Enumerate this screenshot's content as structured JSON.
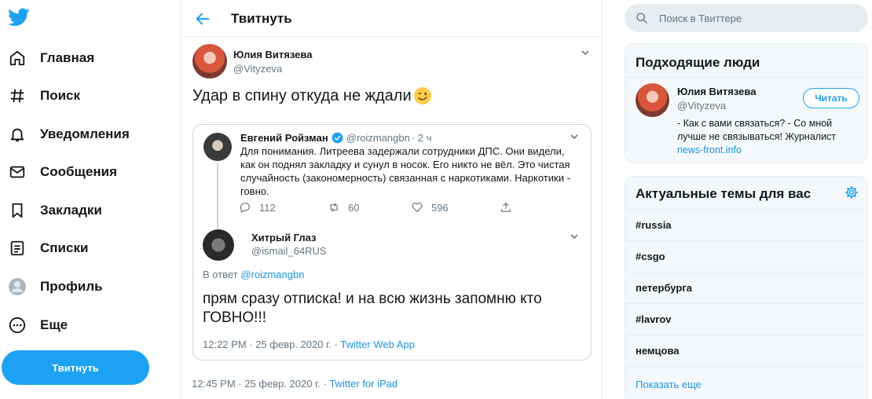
{
  "nav": {
    "items": [
      {
        "label": "Главная",
        "icon": "home-icon"
      },
      {
        "label": "Поиск",
        "icon": "hashtag-icon"
      },
      {
        "label": "Уведомления",
        "icon": "bell-icon"
      },
      {
        "label": "Сообщения",
        "icon": "envelope-icon"
      },
      {
        "label": "Закладки",
        "icon": "bookmark-icon"
      },
      {
        "label": "Списки",
        "icon": "list-icon"
      },
      {
        "label": "Профиль",
        "icon": "avatar-icon"
      },
      {
        "label": "Еще",
        "icon": "more-icon"
      }
    ],
    "tweet_button": "Твитнуть"
  },
  "header": {
    "title": "Твитнуть"
  },
  "tweet": {
    "author_name": "Юлия Витязева",
    "author_handle": "@Vityzeva",
    "text": "Удар в спину откуда не ждали",
    "timestamp": "12:45 PM · 25 февр. 2020 г.",
    "separator": " · ",
    "source": "Twitter for iPad"
  },
  "quoted_parent": {
    "author_name": "Евгений Ройзман",
    "author_handle": "@roizmangbn",
    "time": "· 2 ч",
    "text": "Для понимания. Литреева задержали сотрудники ДПС. Они видели, как он поднял закладку и сунул в носок. Его никто не вёл. Это чистая случайность (закономерность) связанная с наркотиками. Наркотики - говно.",
    "replies": "112",
    "retweets": "60",
    "likes": "596"
  },
  "quoted_reply": {
    "author_name": "Хитрый Глаз",
    "author_handle": "@ismail_64RUS",
    "reply_prefix": "В ответ ",
    "reply_to": "@roizmangbn",
    "text": "прям сразу отписка! и на всю жизнь запомню кто ГОВНО!!!",
    "timestamp": "12:22 PM · 25 февр. 2020 г.",
    "separator": " · ",
    "source": "Twitter Web App"
  },
  "search": {
    "placeholder": "Поиск в Твиттере"
  },
  "who_to_follow": {
    "title": "Подходящие люди",
    "name": "Юлия Витязева",
    "handle": "@Vityzeva",
    "follow_label": "Читать",
    "bio": "- Как с вами связаться? - Со мной лучше не связываться! Журналист",
    "bio_link": "news-front.info"
  },
  "trends": {
    "title": "Актуальные темы для вас",
    "items": [
      "#russia",
      "#csgo",
      "петербурга",
      "#lavrov",
      "немцова"
    ],
    "show_more": "Показать еще"
  },
  "colors": {
    "accent": "#1da1f2",
    "link": "#1b95e0",
    "muted": "#657786",
    "border": "#e6ecf0"
  }
}
